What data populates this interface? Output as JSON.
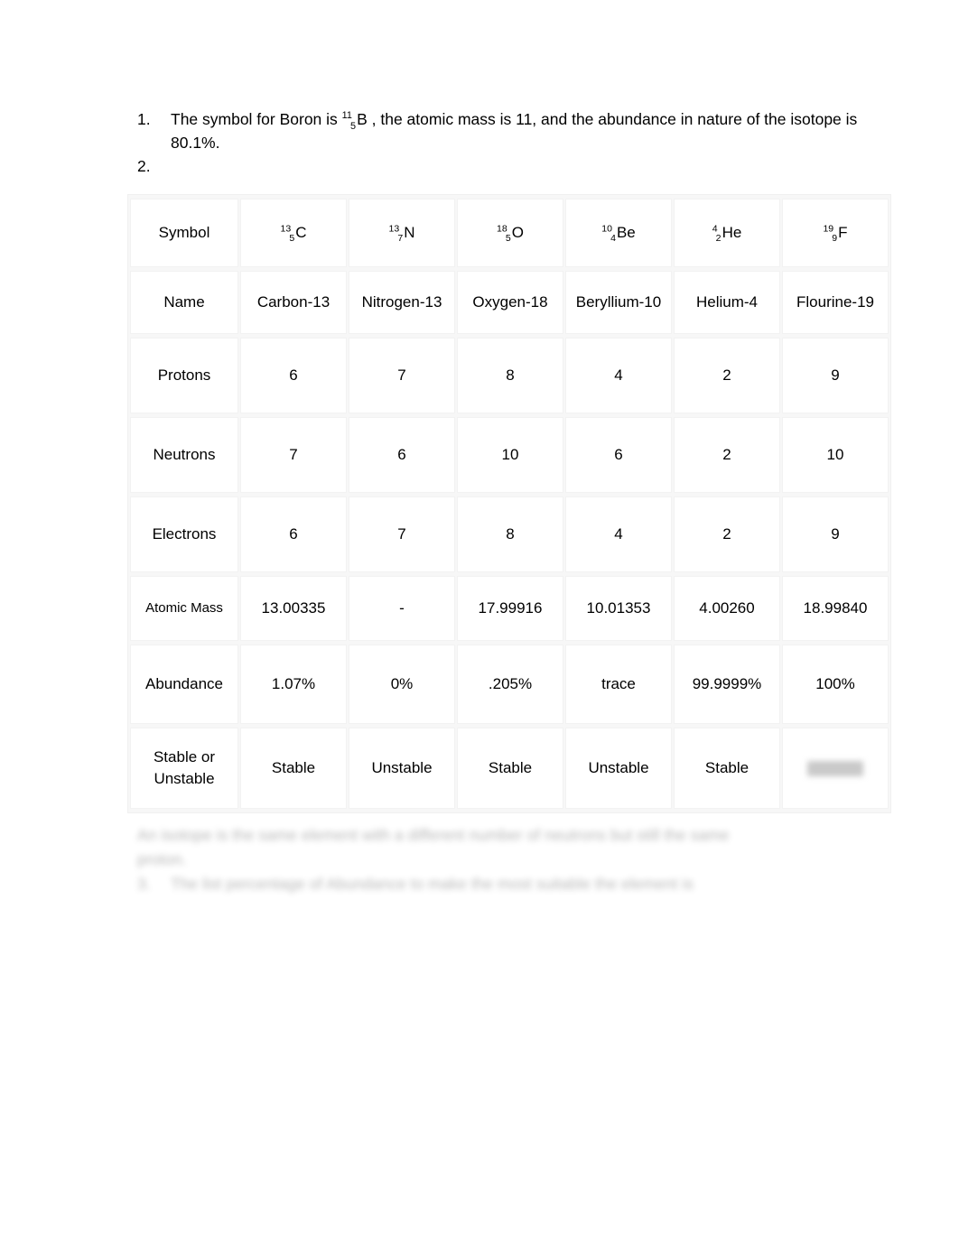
{
  "document": {
    "list": [
      {
        "marker": "1.",
        "text_before": "The symbol for Boron is ",
        "isotope": {
          "mass_number": "11",
          "atomic_number": "5",
          "element": "B"
        },
        "text_after": " , the atomic mass is 11, and the abundance in nature of the isotope is 80.1%."
      },
      {
        "marker": "2.",
        "text_before": "",
        "text_after": ""
      }
    ],
    "table": {
      "row_labels": [
        "Symbol",
        "Name",
        "Protons",
        "Neutrons",
        "Electrons",
        "Atomic Mass",
        "Abundance",
        "Stable or Unstable"
      ],
      "symbols": [
        {
          "mass_number": "13",
          "atomic_number": "5",
          "element": "C"
        },
        {
          "mass_number": "13",
          "atomic_number": "7",
          "element": "N"
        },
        {
          "mass_number": "18",
          "atomic_number": "5",
          "element": "O"
        },
        {
          "mass_number": "10",
          "atomic_number": "4",
          "element": "Be"
        },
        {
          "mass_number": "4",
          "atomic_number": "2",
          "element": "He"
        },
        {
          "mass_number": "19",
          "atomic_number": "9",
          "element": "F"
        }
      ],
      "names": [
        "Carbon-13",
        "Nitrogen-13",
        "Oxygen-18",
        "Beryllium-10",
        "Helium-4",
        "Flourine-19"
      ],
      "protons": [
        "6",
        "7",
        "8",
        "4",
        "2",
        "9"
      ],
      "neutrons": [
        "7",
        "6",
        "10",
        "6",
        "2",
        "10"
      ],
      "electrons": [
        "6",
        "7",
        "8",
        "4",
        "2",
        "9"
      ],
      "atomic_mass": [
        "13.00335",
        "-",
        "17.99916",
        "10.01353",
        "4.00260",
        "18.99840"
      ],
      "abundance": [
        "1.07%",
        "0%",
        ".205%",
        "trace",
        "99.9999%",
        "100%"
      ],
      "stability": [
        "Stable",
        "Unstable",
        "Stable",
        "Unstable",
        "Stable",
        ""
      ],
      "stability_last_redacted": true
    },
    "footer_notes": {
      "redacted": true,
      "line1": "An isotope is the same element with a different number of neutrons but still the same",
      "line2": "proton.",
      "item_marker": "3.",
      "line3": "The list percentage of Abundance to make the most suitable the element is"
    }
  },
  "colors": {
    "page_background": "#ffffff",
    "text": "#000000",
    "table_gridline": "#f2f2f2",
    "table_gap": "#f7f7f7",
    "redaction": "#c9c9c9"
  }
}
